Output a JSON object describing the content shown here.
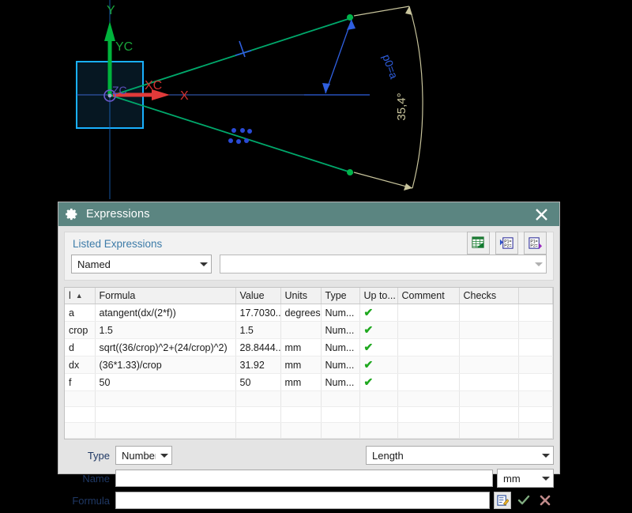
{
  "viewport": {
    "labels": {
      "y_axis": "Y",
      "yc_axis": "YC",
      "x_axis": "X",
      "xc_axis": "XC",
      "zc_origin": "ZC",
      "angle_expression": "p0=a",
      "arc_dimension": "35,4°"
    },
    "colors": {
      "background": "#000000",
      "y_axis": "#00b33c",
      "x_axis": "#e03a3a",
      "sketch_line": "#00a86b",
      "selection_rect": "#19b0ff",
      "dimension": "#c8c49c",
      "annotation": "#2f5fe0",
      "marker": "#2a4ad6"
    }
  },
  "dialog": {
    "title": "Expressions",
    "gear_icon": "gear-icon",
    "close_icon": "close-icon",
    "listed": {
      "heading": "Listed Expressions",
      "scope_value": "Named",
      "filter_value": "",
      "toolbar": [
        {
          "name": "open-spreadsheet-button",
          "icon": "spreadsheet-icon"
        },
        {
          "name": "import-expressions-button",
          "icon": "import-expressions-icon"
        },
        {
          "name": "export-expressions-button",
          "icon": "export-expressions-icon"
        }
      ]
    },
    "table": {
      "columns": [
        "l",
        "Formula",
        "Value",
        "Units",
        "Type",
        "Up to...",
        "Comment",
        "Checks",
        ""
      ],
      "sort_indicator": "▲",
      "rows": [
        {
          "name": "a",
          "formula": "atangent(dx/(2*f))",
          "value": "17.7030...",
          "units": "degrees",
          "type": "Num...",
          "uptodate": "✔",
          "comment": "",
          "checks": ""
        },
        {
          "name": "crop",
          "formula": "1.5",
          "value": "1.5",
          "units": "",
          "type": "Num...",
          "uptodate": "✔",
          "comment": "",
          "checks": ""
        },
        {
          "name": "d",
          "formula": "sqrt((36/crop)^2+(24/crop)^2)",
          "value": "28.8444...",
          "units": "mm",
          "type": "Num...",
          "uptodate": "✔",
          "comment": "",
          "checks": ""
        },
        {
          "name": "dx",
          "formula": "(36*1.33)/crop",
          "value": "31.92",
          "units": "mm",
          "type": "Num...",
          "uptodate": "✔",
          "comment": "",
          "checks": ""
        },
        {
          "name": "f",
          "formula": "50",
          "value": "50",
          "units": "mm",
          "type": "Num...",
          "uptodate": "✔",
          "comment": "",
          "checks": ""
        },
        {
          "name": "",
          "formula": "",
          "value": "",
          "units": "",
          "type": "",
          "uptodate": "",
          "comment": "",
          "checks": ""
        },
        {
          "name": "",
          "formula": "",
          "value": "",
          "units": "",
          "type": "",
          "uptodate": "",
          "comment": "",
          "checks": ""
        },
        {
          "name": "",
          "formula": "",
          "value": "",
          "units": "",
          "type": "",
          "uptodate": "",
          "comment": "",
          "checks": ""
        }
      ]
    },
    "form": {
      "type_label": "Type",
      "type_value": "Number",
      "dimensionality_value": "Length",
      "name_label": "Name",
      "name_value": "",
      "unit_value": "mm",
      "formula_label": "Formula",
      "formula_value": "",
      "accept_icon": "check-icon",
      "cancel_icon": "cross-icon",
      "editor_icon": "formula-editor-icon"
    }
  }
}
